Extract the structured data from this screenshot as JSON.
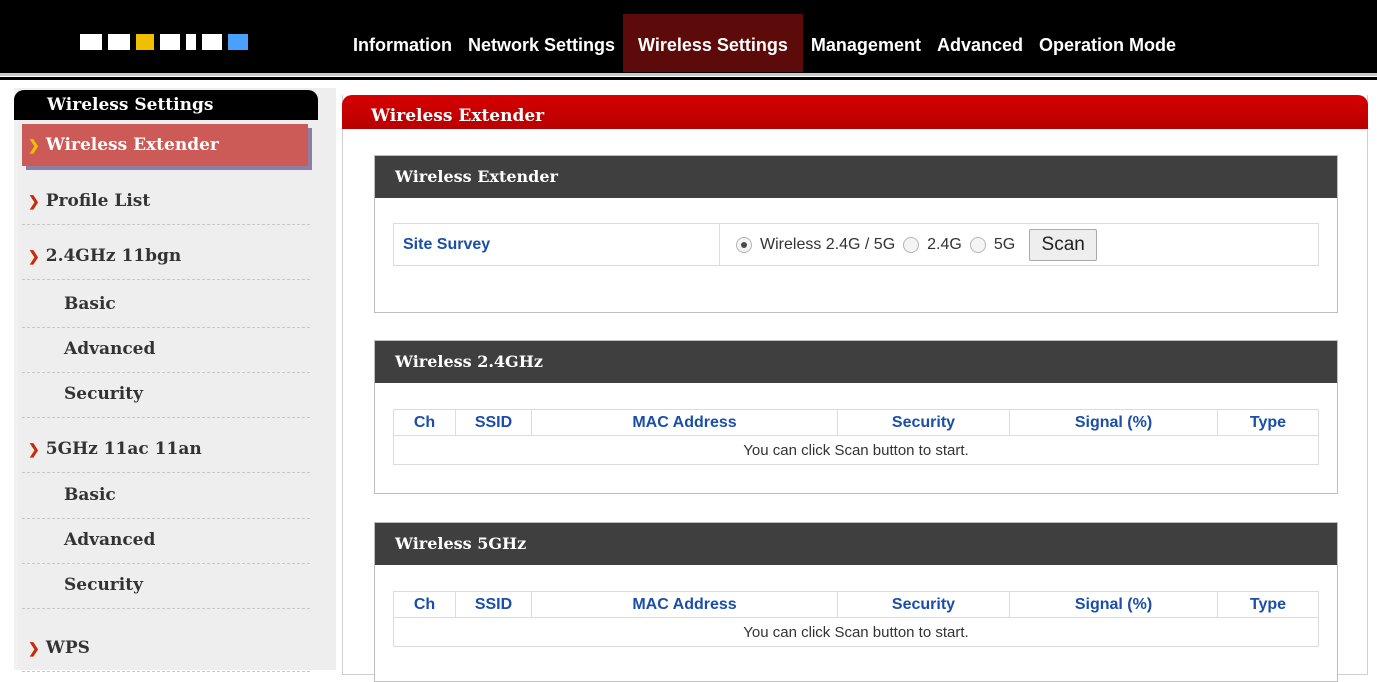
{
  "topnav": {
    "items": [
      {
        "label": "Information"
      },
      {
        "label": "Network Settings"
      },
      {
        "label": "Wireless Settings"
      },
      {
        "label": "Management"
      },
      {
        "label": "Advanced"
      },
      {
        "label": "Operation Mode"
      }
    ],
    "active": "Wireless Settings"
  },
  "sidebar": {
    "title": "Wireless Settings",
    "items": [
      {
        "label": "Wireless Extender"
      },
      {
        "label": "Profile List"
      },
      {
        "label": "2.4GHz 11bgn"
      },
      {
        "label": "Basic"
      },
      {
        "label": "Advanced"
      },
      {
        "label": "Security"
      },
      {
        "label": "5GHz 11ac 11an"
      },
      {
        "label": "Basic"
      },
      {
        "label": "Advanced"
      },
      {
        "label": "Security"
      },
      {
        "label": "WPS"
      }
    ]
  },
  "main": {
    "title": "Wireless Extender",
    "extender_section": {
      "title": "Wireless Extender",
      "site_survey_label": "Site Survey",
      "options": [
        "Wireless 2.4G / 5G",
        "2.4G",
        "5G"
      ],
      "selected": "Wireless 2.4G / 5G",
      "scan_label": "Scan"
    },
    "wifi24": {
      "title": "Wireless 2.4GHz",
      "columns": [
        "Ch",
        "SSID",
        "MAC Address",
        "Security",
        "Signal (%)",
        "Type"
      ],
      "message": "You can click Scan button to start."
    },
    "wifi5": {
      "title": "Wireless 5GHz",
      "columns": [
        "Ch",
        "SSID",
        "MAC Address",
        "Security",
        "Signal (%)",
        "Type"
      ],
      "message": "You can click Scan button to start."
    }
  },
  "colors": {
    "accent_red": "#c40000",
    "active_item": "#cc5b58",
    "label_blue": "#1a4ea8",
    "section_header": "#3f3f3f"
  }
}
